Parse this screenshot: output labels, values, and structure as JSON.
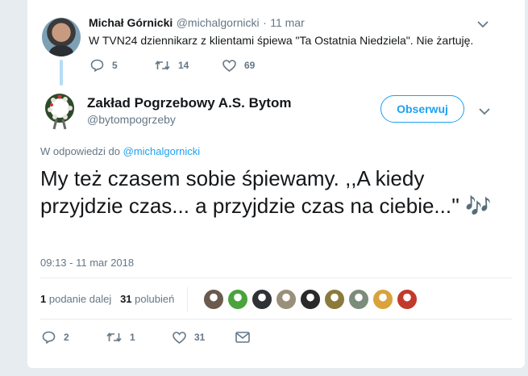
{
  "parent_tweet": {
    "author_name": "Michał Górnicki",
    "author_handle": "@michalgornicki",
    "separator": "·",
    "date": "11 mar",
    "text": "W TVN24 dziennikarz z klientami śpiewa \"Ta Ostatnia Niedziela\". Nie żartuję.",
    "actions": {
      "reply_count": "5",
      "retweet_count": "14",
      "like_count": "69"
    }
  },
  "main_tweet": {
    "author_name": "Zakład Pogrzebowy A.S. Bytom",
    "author_handle": "@bytompogrzeby",
    "follow_label": "Obserwuj",
    "reply_prefix": "W odpowiedzi do",
    "reply_handle": "@michalgornicki",
    "text": "My też czasem sobie śpiewamy. ,,A kiedy przyjdzie czas... a przyjdzie czas na ciebie...''",
    "emoji": "🎶",
    "timestamp": "09:13 - 11 mar 2018",
    "stats": {
      "retweets_count": "1",
      "retweets_label": "podanie dalej",
      "likes_count": "31",
      "likes_label": "polubień"
    },
    "actions": {
      "reply_count": "2",
      "retweet_count": "1",
      "like_count": "31"
    }
  },
  "icons": {
    "reply": "reply-icon",
    "retweet": "retweet-icon",
    "like": "heart-icon",
    "dm": "envelope-icon",
    "menu": "chevron-down-icon"
  },
  "colors": {
    "brand_blue": "#1da1f2",
    "secondary_text": "#657786",
    "thread_line": "#b5dcf7",
    "background": "#e6ecf0"
  },
  "liker_avatars": [
    {
      "color": "#6b5a4d"
    },
    {
      "color": "#4aa33c"
    },
    {
      "color": "#2f3336"
    },
    {
      "color": "#9a8f7a"
    },
    {
      "color": "#2a2a2a"
    },
    {
      "color": "#8a7a3c"
    },
    {
      "color": "#7c8c7a"
    },
    {
      "color": "#d9a23c"
    },
    {
      "color": "#c23a2c"
    }
  ]
}
